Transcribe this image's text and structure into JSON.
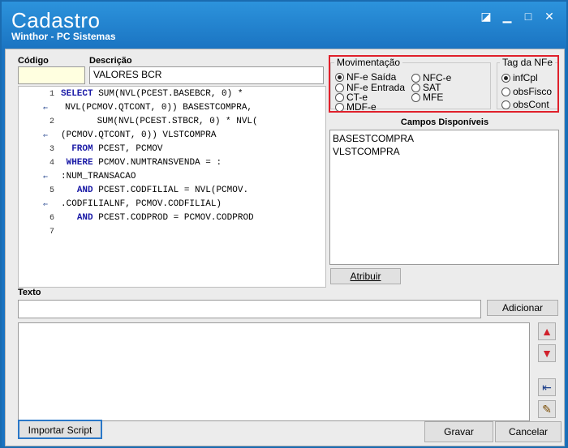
{
  "window": {
    "title": "Cadastro",
    "subtitle": "Winthor - PC Sistemas"
  },
  "form": {
    "codigo_label": "Código",
    "codigo_value": "",
    "descricao_label": "Descrição",
    "descricao_value": "VALORES BCR"
  },
  "editor": {
    "line_numbers": [
      "1",
      "2",
      "3",
      "4",
      "5",
      "6",
      "7"
    ]
  },
  "movimentacao": {
    "title": "Movimentação",
    "options": [
      "NF-e Saída",
      "NF-e Entrada",
      "CT-e",
      "MDF-e",
      "NFC-e",
      "SAT",
      "MFE"
    ],
    "selected": "NF-e Saída"
  },
  "tag_nfe": {
    "title": "Tag da NFe",
    "options": [
      "infCpl",
      "obsFisco",
      "obsCont"
    ],
    "selected": "infCpl"
  },
  "campos": {
    "title": "Campos Disponíveis",
    "items": [
      "BASESTCOMPRA",
      "VLSTCOMPRA"
    ],
    "atribuir_label": "Atribuir"
  },
  "texto": {
    "label": "Texto",
    "value": "",
    "adicionar_label": "Adicionar"
  },
  "footer": {
    "importar_label": "Importar Script",
    "gravar_label": "Gravar",
    "cancelar_label": "Cancelar"
  },
  "colors": {
    "title_bar": "#1f7fc8",
    "highlight_border": "#e0202b",
    "keyword": "#1a1aa6"
  }
}
